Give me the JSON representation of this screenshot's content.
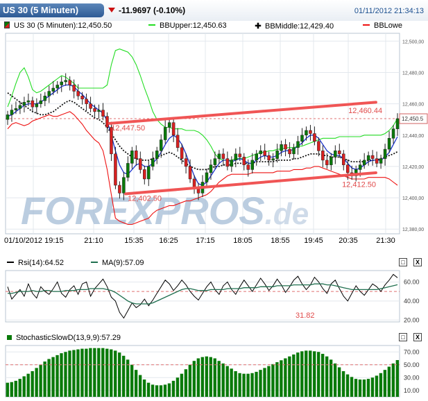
{
  "header": {
    "title": "US 30 (5 Minuten)",
    "change": "-11.9697 (-0.10%)",
    "timestamp": "01/11/2012 21:34:13"
  },
  "legend": {
    "instrument": "US 30 (5 Minuten):12,450.50",
    "bb_upper": "BBUpper:12,450.63",
    "bb_middle": "BBMiddle:12,429.40",
    "bb_lower": "BBLowe"
  },
  "colors": {
    "up": "#0a7a0a",
    "down": "#d92020",
    "bb_upper": "#22dd22",
    "bb_lower": "#ee1111",
    "bb_middle": "#111111",
    "ma": "#1a33cc",
    "trend": "#f05555",
    "rsi": "#000000",
    "rsi_ma": "#1f6f4f",
    "stoch": "#0a7a0a",
    "title_bg": "#2d5a95"
  },
  "watermark": {
    "text_main": "FOREXPROS",
    "text_suffix": ".de"
  },
  "icons": {
    "minimize": "minimize-icon",
    "close": "close-icon",
    "change_arrow": "triangle-down-icon"
  },
  "buttons": {
    "minimize_label": "□",
    "close_label": "X"
  },
  "chart_data": [
    {
      "type": "candlestick",
      "title": "US 30 (5 Minuten)",
      "x_labels": [
        "01/10/2012 19:15",
        "21:10",
        "15:35",
        "16:25",
        "17:15",
        "18:05",
        "18:55",
        "19:45",
        "20:35",
        "21:30"
      ],
      "ylim": [
        12377,
        12505
      ],
      "y_ticks": [
        12380,
        12400,
        12420,
        12440,
        12460,
        12480,
        12500
      ],
      "y_tick_labels": [
        "12,380,00",
        "12,400,00",
        "12,420,00",
        "12,440,00",
        "12,460,00",
        "12,480,00",
        "12,500,00"
      ],
      "last_price": 12450.5,
      "last_price_label": "12,450.5",
      "grid": true,
      "close": [
        12453,
        12456,
        12457,
        12459,
        12461,
        12462,
        12458,
        12460,
        12462,
        12465,
        12468,
        12470,
        12472,
        12474,
        12475,
        12472,
        12468,
        12465,
        12463,
        12460,
        12457,
        12455,
        12456,
        12452,
        12445,
        12428,
        12408,
        12403,
        12413,
        12422,
        12430,
        12425,
        12418,
        12412,
        12420,
        12425,
        12430,
        12437,
        12445,
        12448,
        12440,
        12432,
        12425,
        12420,
        12412,
        12406,
        12403,
        12410,
        12416,
        12421,
        12425,
        12428,
        12425,
        12420,
        12424,
        12428,
        12426,
        12421,
        12418,
        12424,
        12428,
        12430,
        12427,
        12424,
        12425,
        12430,
        12434,
        12431,
        12428,
        12432,
        12436,
        12440,
        12443,
        12441,
        12436,
        12430,
        12424,
        12421,
        12426,
        12430,
        12428,
        12421,
        12416,
        12414,
        12418,
        12421,
        12424,
        12427,
        12425,
        12422,
        12425,
        12431,
        12438,
        12444,
        12450.5
      ],
      "bb_upper": [
        12458,
        12465,
        12473,
        12480,
        12483,
        12477,
        12469,
        12467,
        12468,
        12470,
        12472,
        12474,
        12476,
        12478,
        12477,
        12475,
        12473,
        12470,
        12470,
        12470,
        12470,
        12470,
        12470,
        12470,
        12472,
        12485,
        12494,
        12495,
        12494,
        12493,
        12490,
        12485,
        12478,
        12470,
        12463,
        12455,
        12450,
        12447,
        12445,
        12445,
        12444,
        12444,
        12444,
        12443,
        12443,
        12443,
        12442,
        12440,
        12437,
        12433,
        12428,
        12425,
        12424,
        12424,
        12424,
        12425,
        12425,
        12425,
        12426,
        12427,
        12428,
        12429,
        12429,
        12430,
        12430,
        12431,
        12431,
        12432,
        12432,
        12432,
        12433,
        12433,
        12434,
        12435,
        12436,
        12437,
        12438,
        12438,
        12438,
        12438,
        12439,
        12439,
        12439,
        12439,
        12439,
        12439,
        12440,
        12440,
        12440,
        12440,
        12440,
        12441,
        12443,
        12446,
        12450.63
      ],
      "bb_middle": [
        12467,
        12465,
        12463,
        12461,
        12459,
        12457,
        12455,
        12454,
        12453,
        12453,
        12454,
        12455,
        12457,
        12459,
        12461,
        12462,
        12461,
        12459,
        12457,
        12455,
        12453,
        12451,
        12450,
        12448,
        12445,
        12441,
        12437,
        12433,
        12430,
        12428,
        12426,
        12425,
        12424,
        12424,
        12424,
        12425,
        12426,
        12427,
        12428,
        12429,
        12428,
        12426,
        12424,
        12422,
        12420,
        12419,
        12418,
        12418,
        12418,
        12419,
        12420,
        12420,
        12421,
        12421,
        12421,
        12422,
        12422,
        12422,
        12422,
        12422,
        12423,
        12423,
        12423,
        12423,
        12423,
        12424,
        12424,
        12424,
        12424,
        12425,
        12425,
        12426,
        12427,
        12428,
        12428,
        12428,
        12427,
        12427,
        12426,
        12426,
        12426,
        12425,
        12424,
        12423,
        12423,
        12423,
        12423,
        12424,
        12424,
        12424,
        12425,
        12426,
        12427,
        12428,
        12429.4
      ],
      "bb_lower": [
        12444,
        12447,
        12448,
        12447,
        12446,
        12447,
        12449,
        12450,
        12451,
        12452,
        12453,
        12452,
        12452,
        12453,
        12454,
        12455,
        12453,
        12450,
        12447,
        12443,
        12440,
        12437,
        12435,
        12430,
        12418,
        12402,
        12387,
        12385,
        12384,
        12383,
        12383,
        12384,
        12385,
        12386,
        12387,
        12390,
        12392,
        12393,
        12394,
        12395,
        12395,
        12396,
        12397,
        12398,
        12398,
        12399,
        12400,
        12401,
        12402,
        12404,
        12407,
        12410,
        12412,
        12414,
        12415,
        12415,
        12415,
        12415,
        12415,
        12416,
        12416,
        12416,
        12416,
        12416,
        12416,
        12417,
        12417,
        12417,
        12417,
        12418,
        12418,
        12418,
        12419,
        12419,
        12420,
        12420,
        12419,
        12418,
        12417,
        12416,
        12415,
        12414,
        12413,
        12412,
        12412,
        12412,
        12412,
        12413,
        12413,
        12413,
        12413,
        12413,
        12412,
        12410,
        12408
      ],
      "ma": [
        12452,
        12453,
        12455,
        12457,
        12459,
        12460,
        12460,
        12460,
        12461,
        12463,
        12465,
        12467,
        12469,
        12471,
        12472,
        12472,
        12471,
        12468,
        12466,
        12463,
        12460,
        12458,
        12456,
        12454,
        12449,
        12440,
        12430,
        12421,
        12416,
        12415,
        12418,
        12421,
        12422,
        12420,
        12420,
        12422,
        12425,
        12429,
        12434,
        12438,
        12440,
        12438,
        12434,
        12428,
        12421,
        12414,
        12409,
        12408,
        12410,
        12414,
        12418,
        12422,
        12424,
        12424,
        12423,
        12424,
        12425,
        12424,
        12422,
        12422,
        12424,
        12426,
        12427,
        12426,
        12426,
        12427,
        12429,
        12430,
        12430,
        12431,
        12433,
        12435,
        12438,
        12440,
        12440,
        12438,
        12434,
        12430,
        12428,
        12427,
        12427,
        12425,
        12422,
        12419,
        12418,
        12419,
        12421,
        12423,
        12424,
        12424,
        12424,
        12426,
        12429,
        12434,
        12439
      ],
      "trend_lines": [
        {
          "label": "12,447.50",
          "from": [
            0.264,
            12447.5
          ],
          "to": [
            0.94,
            12461
          ],
          "label_at": [
            0.268,
            12443
          ]
        },
        {
          "label": "12,402.50",
          "from": [
            0.305,
            12402.5
          ],
          "to": [
            0.94,
            12416
          ],
          "label_at": [
            0.31,
            12398
          ]
        },
        {
          "label": "12,460.44",
          "label_at": [
            0.87,
            12454
          ]
        },
        {
          "label": "12,412.50",
          "label_at": [
            0.854,
            12407
          ]
        }
      ]
    },
    {
      "type": "line",
      "title": "Rsi(14):64.52",
      "series": [
        {
          "name": "Rsi(14):64.52",
          "values": [
            55,
            42,
            47,
            52,
            45,
            58,
            48,
            43,
            55,
            50,
            47,
            53,
            60,
            48,
            44,
            52,
            56,
            47,
            58,
            60,
            45,
            53,
            58,
            63,
            55,
            44,
            40,
            28,
            22,
            30,
            38,
            33,
            36,
            42,
            35,
            41,
            48,
            55,
            62,
            58,
            51,
            56,
            62,
            57,
            50,
            45,
            41,
            48,
            55,
            60,
            52,
            47,
            56,
            60,
            52,
            47,
            55,
            62,
            56,
            50,
            57,
            64,
            58,
            51,
            56,
            63,
            57,
            49,
            55,
            62,
            66,
            58,
            52,
            57,
            65,
            60,
            53,
            48,
            58,
            62,
            53,
            45,
            40,
            48,
            56,
            50,
            46,
            52,
            58,
            55,
            50,
            57,
            62,
            68,
            64.52
          ]
        },
        {
          "name": "MA(9):57.09",
          "values": [
            48,
            48,
            49,
            50,
            50,
            50,
            51,
            50,
            50,
            51,
            51,
            50,
            50,
            50,
            51,
            51,
            51,
            52,
            52,
            52,
            53,
            53,
            53,
            53,
            52,
            51,
            49,
            46,
            43,
            40,
            38,
            37,
            37,
            37,
            37,
            38,
            40,
            42,
            44,
            46,
            48,
            50,
            52,
            53,
            53,
            52,
            51,
            51,
            51,
            52,
            52,
            52,
            52,
            53,
            53,
            53,
            53,
            54,
            54,
            54,
            54,
            55,
            55,
            55,
            55,
            56,
            56,
            56,
            56,
            57,
            57,
            57,
            57,
            57,
            58,
            58,
            58,
            57,
            57,
            56,
            55,
            54,
            53,
            52,
            52,
            52,
            52,
            52,
            52,
            52,
            53,
            54,
            55,
            56,
            57.09
          ]
        }
      ],
      "ylim": [
        18,
        72
      ],
      "y_ticks": [
        20,
        40,
        60
      ],
      "y_tick_labels": [
        "20.00",
        "40.00",
        "60.00"
      ],
      "reference_line": 50,
      "annotation": "31.82"
    },
    {
      "type": "bar",
      "title": "StochasticSlowD(13,9,9):57.29",
      "values": [
        22,
        23,
        25,
        28,
        32,
        36,
        40,
        45,
        50,
        55,
        59,
        62,
        65,
        68,
        70,
        72,
        73,
        74,
        75,
        75,
        76,
        76,
        76,
        76,
        75,
        74,
        72,
        69,
        64,
        58,
        50,
        42,
        34,
        27,
        22,
        19,
        18,
        18,
        19,
        21,
        25,
        30,
        36,
        43,
        50,
        56,
        60,
        62,
        63,
        62,
        60,
        56,
        52,
        48,
        44,
        40,
        37,
        36,
        36,
        37,
        39,
        42,
        45,
        48,
        51,
        54,
        57,
        60,
        63,
        66,
        69,
        71,
        72,
        72,
        71,
        70,
        67,
        63,
        58,
        52,
        46,
        40,
        35,
        31,
        28,
        27,
        27,
        28,
        30,
        33,
        37,
        42,
        47,
        52,
        57.29
      ],
      "ylim": [
        0,
        80
      ],
      "y_ticks": [
        10,
        30,
        50,
        70
      ],
      "y_tick_labels": [
        "10.00",
        "30.00",
        "50.00",
        "70.00"
      ],
      "reference_line": 50
    }
  ]
}
